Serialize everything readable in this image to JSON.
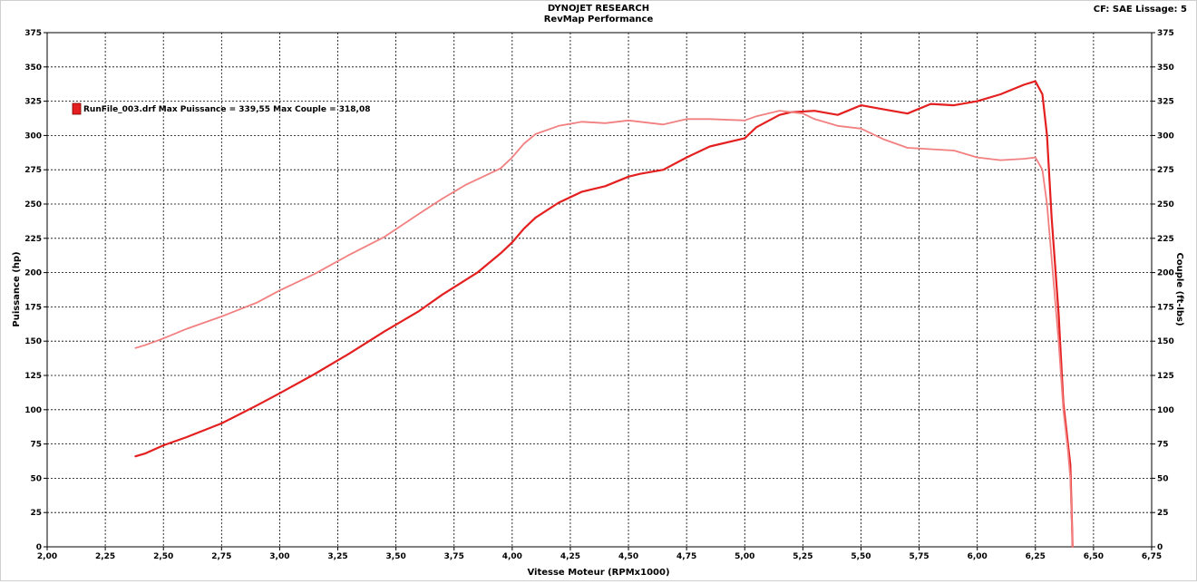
{
  "header": {
    "title": "DYNOJET RESEARCH",
    "subtitle": "RevMap Performance",
    "settings": "CF: SAE  Lissage: 5"
  },
  "legend": {
    "text": "RunFile_003.drf Max Puissance = 339,55 Max Couple = 318,08",
    "swatch_color": "#e41f1f"
  },
  "chart_data": {
    "type": "line",
    "title": "RevMap Performance",
    "xlabel": "Vitesse Moteur (RPMx1000)",
    "ylabel_left": "Puissance (hp)",
    "ylabel_right": "Couple (ft-lbs)",
    "xlim": [
      2.0,
      6.75
    ],
    "ylim_left": [
      0,
      375
    ],
    "ylim_right": [
      0,
      375
    ],
    "grid": true,
    "legend_position": "top-left",
    "x_ticks": [
      "2,00",
      "2,25",
      "2,50",
      "2,75",
      "3,00",
      "3,25",
      "3,50",
      "3,75",
      "4,00",
      "4,25",
      "4,50",
      "4,75",
      "5,00",
      "5,25",
      "5,50",
      "5,75",
      "6,00",
      "6,25",
      "6,50",
      "6,75"
    ],
    "y_ticks_left": [
      "0",
      "25",
      "50",
      "75",
      "100",
      "125",
      "150",
      "175",
      "200",
      "225",
      "250",
      "275",
      "300",
      "325",
      "350",
      "375"
    ],
    "y_ticks_right": [
      "0",
      "25",
      "50",
      "75",
      "100",
      "125",
      "150",
      "175",
      "200",
      "225",
      "250",
      "275",
      "300",
      "325",
      "350",
      "375"
    ],
    "series": [
      {
        "name": "",
        "axis": "left",
        "color": "#e41f1f",
        "x": [
          2.38,
          2.42,
          2.5,
          2.6,
          2.75,
          2.9,
          3.0,
          3.15,
          3.3,
          3.45,
          3.6,
          3.7,
          3.85,
          3.95,
          4.0,
          4.05,
          4.1,
          4.2,
          4.3,
          4.4,
          4.5,
          4.55,
          4.65,
          4.75,
          4.85,
          5.0,
          5.05,
          5.15,
          5.2,
          5.3,
          5.4,
          5.5,
          5.6,
          5.7,
          5.8,
          5.9,
          6.0,
          6.1,
          6.2,
          6.25,
          6.28,
          6.3,
          6.32,
          6.35,
          6.37,
          6.39,
          6.4,
          6.41
        ],
        "values": [
          66,
          68,
          74,
          80,
          90,
          103,
          112,
          126,
          141,
          157,
          172,
          184,
          200,
          214,
          222,
          232,
          240,
          251,
          259,
          263,
          270,
          272,
          275,
          284,
          292,
          298,
          306,
          315,
          317,
          318,
          315,
          322,
          319,
          316,
          323,
          322,
          325,
          330,
          337,
          339.55,
          330,
          300,
          240,
          170,
          105,
          75,
          60,
          0
        ]
      },
      {
        "name": "",
        "axis": "right",
        "color": "#f28080",
        "x": [
          2.38,
          2.42,
          2.5,
          2.6,
          2.75,
          2.9,
          3.0,
          3.15,
          3.3,
          3.45,
          3.6,
          3.7,
          3.8,
          3.95,
          4.0,
          4.05,
          4.1,
          4.2,
          4.3,
          4.4,
          4.5,
          4.55,
          4.65,
          4.75,
          4.85,
          5.0,
          5.05,
          5.15,
          5.25,
          5.3,
          5.4,
          5.5,
          5.6,
          5.7,
          5.8,
          5.9,
          6.0,
          6.1,
          6.2,
          6.25,
          6.28,
          6.3,
          6.32,
          6.35,
          6.37,
          6.39,
          6.4,
          6.41
        ],
        "values": [
          145,
          147,
          152,
          159,
          168,
          178,
          187,
          199,
          213,
          226,
          243,
          254,
          264,
          276,
          284,
          294,
          301,
          307,
          310,
          309,
          311,
          310,
          308,
          312,
          312,
          311,
          314,
          318.08,
          316,
          312,
          307,
          305,
          297,
          291,
          290,
          289,
          284,
          282,
          283,
          284,
          275,
          250,
          210,
          150,
          100,
          70,
          50,
          0
        ]
      }
    ]
  }
}
